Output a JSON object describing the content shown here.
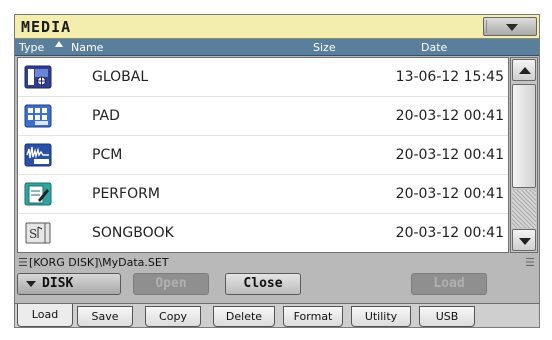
{
  "window": {
    "title": "MEDIA"
  },
  "columns": {
    "type": "Type",
    "name": "Name",
    "size": "Size",
    "date": "Date"
  },
  "files": [
    {
      "name": "GLOBAL",
      "size": "",
      "date": "13-06-12 15:45",
      "icon": "global-icon"
    },
    {
      "name": "PAD",
      "size": "",
      "date": "20-03-12 00:41",
      "icon": "pad-icon"
    },
    {
      "name": "PCM",
      "size": "",
      "date": "20-03-12 00:41",
      "icon": "pcm-icon"
    },
    {
      "name": "PERFORM",
      "size": "",
      "date": "20-03-12 00:41",
      "icon": "perform-icon"
    },
    {
      "name": "SONGBOOK",
      "size": "",
      "date": "20-03-12 00:41",
      "icon": "songbook-icon"
    }
  ],
  "path": "[KORG DISK]\\MyData.SET",
  "buttons": {
    "device": "DISK",
    "open": "Open",
    "close": "Close",
    "load": "Load"
  },
  "tabs": [
    {
      "label": "Load",
      "active": true
    },
    {
      "label": "Save",
      "active": false
    },
    {
      "label": "Copy",
      "active": false
    },
    {
      "label": "Delete",
      "active": false
    },
    {
      "label": "Format",
      "active": false
    },
    {
      "label": "Utility",
      "active": false
    },
    {
      "label": "USB",
      "active": false
    }
  ],
  "colors": {
    "title_bg": "#f3edae",
    "header_bg": "#5a7f9c",
    "panel_bg": "#b9b9b9"
  }
}
